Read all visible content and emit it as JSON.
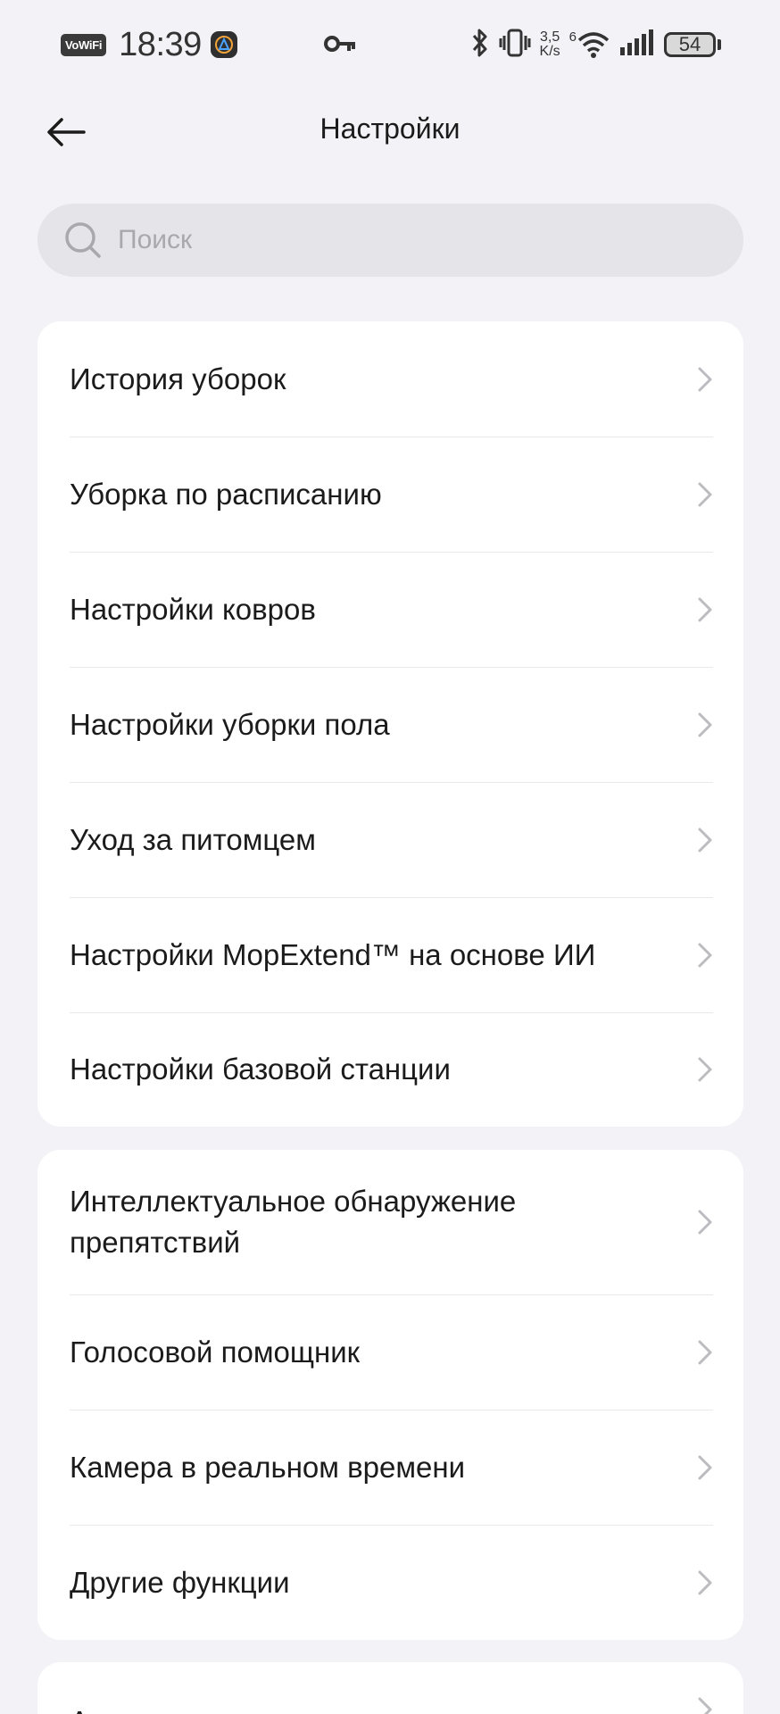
{
  "status_bar": {
    "network_label": "VoWiFi",
    "time": "18:39",
    "speed_value": "3,5",
    "speed_unit": "K/s",
    "wifi_label": "6",
    "battery": "54"
  },
  "header": {
    "title": "Настройки"
  },
  "search": {
    "placeholder": "Поиск"
  },
  "groups": [
    {
      "items": [
        {
          "label": "История уборок"
        },
        {
          "label": "Уборка по расписанию"
        },
        {
          "label": "Настройки ковров"
        },
        {
          "label": "Настройки уборки пола"
        },
        {
          "label": "Уход за питомцем"
        },
        {
          "label": "Настройки MopExtend™ на основе ИИ"
        },
        {
          "label": "Настройки базовой станции"
        }
      ]
    },
    {
      "items": [
        {
          "label": "Интеллектуальное обнаружение препятствий"
        },
        {
          "label": "Голосовой помощник"
        },
        {
          "label": "Камера в реальном времени"
        },
        {
          "label": "Другие функции"
        }
      ]
    },
    {
      "items": [
        {
          "label": "А"
        }
      ]
    }
  ]
}
